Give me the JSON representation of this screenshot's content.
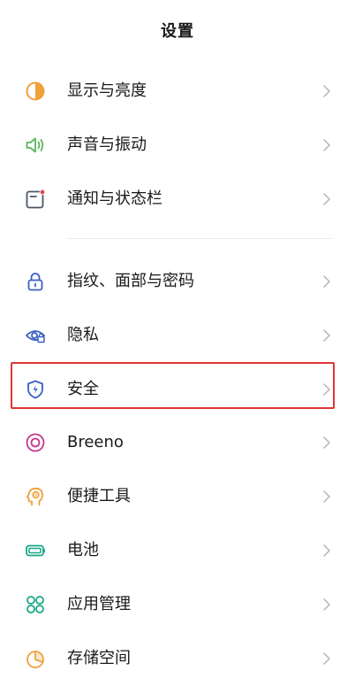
{
  "header": {
    "title": "设置"
  },
  "colors": {
    "highlight_border": "#e03535",
    "chevron": "#b5b5b5",
    "icon_orange": "#f0a13a",
    "icon_green": "#5bb55d",
    "icon_slate": "#4b5568",
    "icon_red_dot": "#e24a4a",
    "icon_blue": "#3b5fc2",
    "icon_pink": "#c2378e",
    "icon_teal": "#1aa887"
  },
  "settings": {
    "group1": [
      {
        "label": "显示与亮度",
        "icon": "display-brightness-icon"
      },
      {
        "label": "声音与振动",
        "icon": "speaker-icon"
      },
      {
        "label": "通知与状态栏",
        "icon": "notification-icon"
      }
    ],
    "group2": [
      {
        "label": "指纹、面部与密码",
        "icon": "lock-icon"
      },
      {
        "label": "隐私",
        "icon": "privacy-eye-icon"
      },
      {
        "label": "安全",
        "icon": "shield-icon",
        "highlighted": true
      },
      {
        "label": "Breeno",
        "icon": "breeno-icon"
      },
      {
        "label": "便捷工具",
        "icon": "convenient-tools-icon"
      },
      {
        "label": "电池",
        "icon": "battery-icon"
      },
      {
        "label": "应用管理",
        "icon": "app-management-icon"
      },
      {
        "label": "存储空间",
        "icon": "storage-icon"
      }
    ]
  }
}
